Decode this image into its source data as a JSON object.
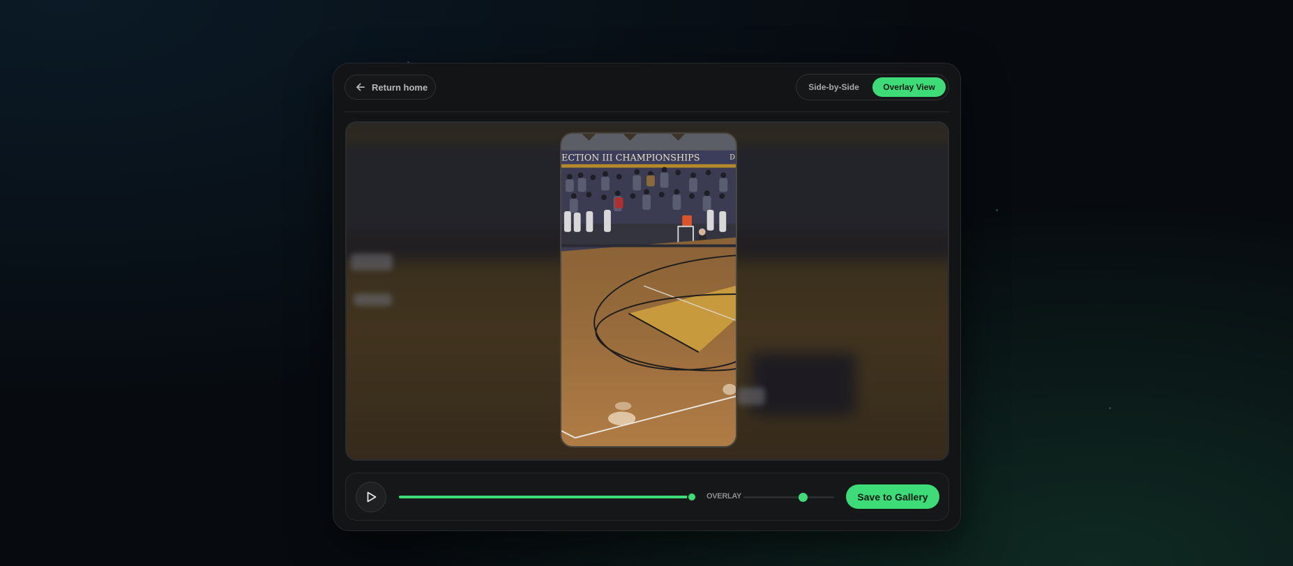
{
  "header": {
    "home_button_label": "Return home",
    "home_icon": "arrow-left-icon",
    "view_toggle": {
      "options": [
        "Side-by-Side",
        "Overlay View"
      ],
      "selected": "Overlay View"
    }
  },
  "media": {
    "banner_text": "ECTION III CHAMPIONSHIPS",
    "banner_suffix": "D"
  },
  "controls": {
    "play_icon": "play-icon",
    "progress": 0.985,
    "overlay_label": "OVERLAY",
    "overlay_opacity": 0.65,
    "save_label": "Save to Gallery"
  },
  "colors": {
    "accent": "#3ddc78",
    "card_bg": "#131415",
    "page_bg": "#070b10"
  }
}
